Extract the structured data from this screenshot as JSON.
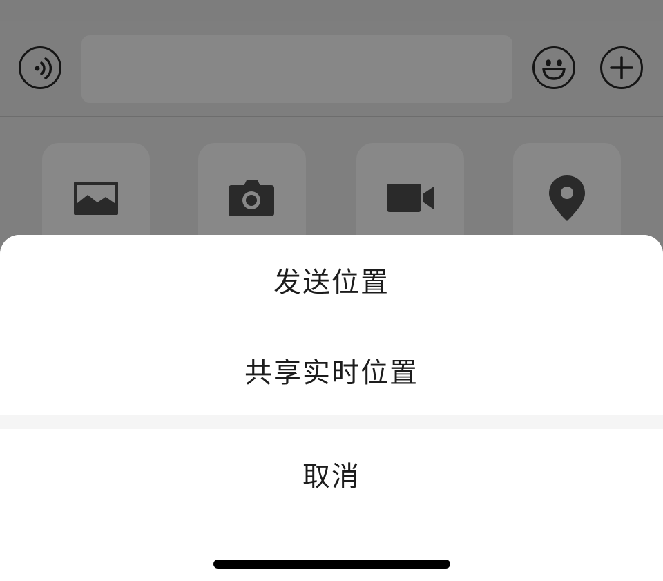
{
  "input_bar": {
    "voice_icon": "voice-wave-icon",
    "text_value": "",
    "text_placeholder": "",
    "emoji_icon": "emoji-smile-icon",
    "more_icon": "plus-icon"
  },
  "panel": {
    "tiles": [
      {
        "icon": "image-icon"
      },
      {
        "icon": "camera-icon"
      },
      {
        "icon": "video-camera-icon"
      },
      {
        "icon": "location-pin-icon"
      }
    ]
  },
  "action_sheet": {
    "send_location": "发送位置",
    "share_live_location": "共享实时位置",
    "cancel": "取消"
  },
  "colors": {
    "overlay": "#808080",
    "sheet_background": "#ffffff",
    "sheet_text": "#1c1c1c",
    "separator_gap": "#f5f5f5",
    "icon_dark": "#2a2a2a"
  }
}
